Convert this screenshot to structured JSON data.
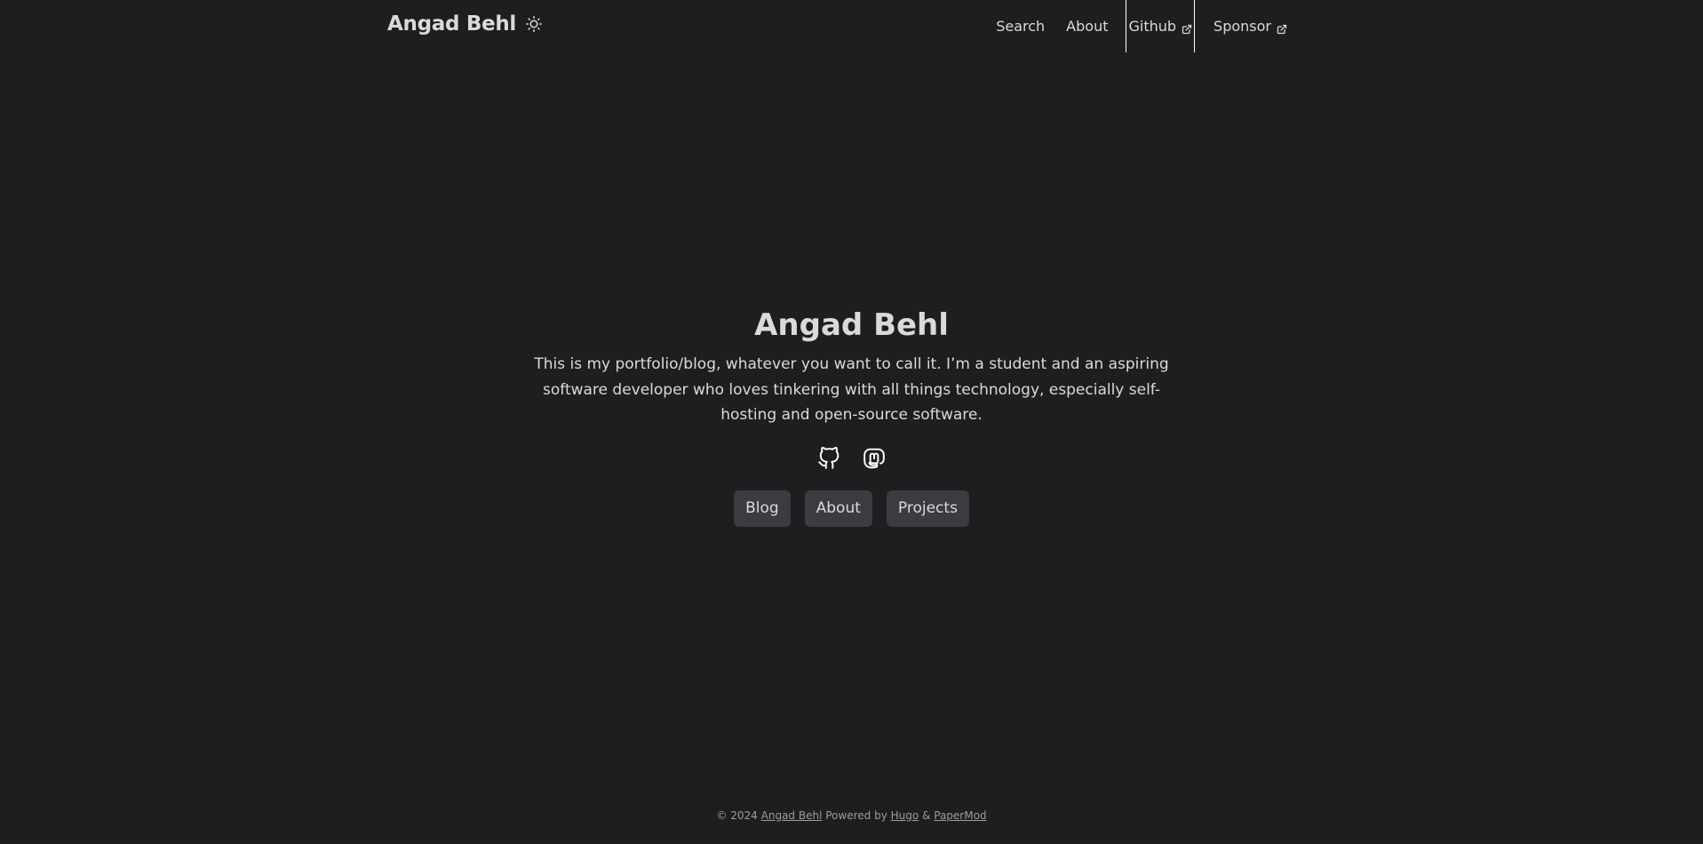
{
  "header": {
    "logo": "Angad Behl",
    "theme_toggle_icon": "sun-icon",
    "nav": [
      {
        "label": "Search"
      },
      {
        "label": "About"
      },
      {
        "label": "Github",
        "icon": "external-link-icon"
      },
      {
        "label": "Sponsor",
        "icon": "external-link-icon"
      }
    ]
  },
  "hero": {
    "title": "Angad Behl",
    "description": "This is my portfolio/blog, whatever you want to call it. I’m a student and an aspiring software developer who loves tinkering with all things technology, especially self-hosting and open-source software.",
    "social_icons": [
      "github-icon",
      "mastodon-icon"
    ],
    "buttons": [
      {
        "label": "Blog"
      },
      {
        "label": "About"
      },
      {
        "label": "Projects"
      }
    ]
  },
  "footer": {
    "copyright": "© 2024",
    "author_link": "Angad Behl",
    "powered_by": "Powered by",
    "hugo_link": "Hugo",
    "ampersand": "&",
    "papermod_link": "PaperMod"
  },
  "colors": {
    "background": "#1d1e20",
    "text": "#dadadb",
    "button_bg": "#3b3c3f",
    "footer_text": "#9b9c9d"
  }
}
